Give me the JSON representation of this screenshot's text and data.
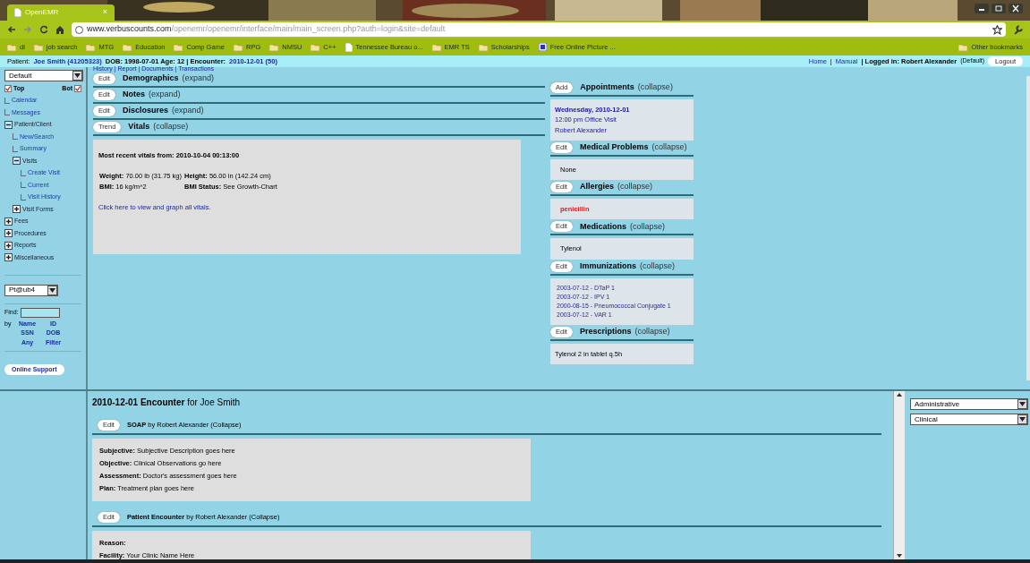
{
  "browser": {
    "tab": {
      "title": "OpenEMR",
      "close": "×"
    },
    "url": {
      "host": "www.verbuscounts.com",
      "path": "/openemr/openemr/interface/main/main_screen.php?auth=login&site=default"
    },
    "bookmarks": [
      {
        "label": "dl",
        "kind": "folder"
      },
      {
        "label": "job search",
        "kind": "folder"
      },
      {
        "label": "MTG",
        "kind": "folder"
      },
      {
        "label": "Education",
        "kind": "folder"
      },
      {
        "label": "Comp Game",
        "kind": "folder"
      },
      {
        "label": "RPG",
        "kind": "folder"
      },
      {
        "label": "NMSU",
        "kind": "folder"
      },
      {
        "label": "C++",
        "kind": "folder"
      },
      {
        "label": "Tennessee Bureau o...",
        "kind": "page"
      },
      {
        "label": "EMR TS",
        "kind": "folder"
      },
      {
        "label": "Scholarships",
        "kind": "folder"
      },
      {
        "label": "Free Online Picture ...",
        "kind": "app"
      }
    ],
    "other_bookmarks": "Other bookmarks"
  },
  "patient_bar": {
    "label": "Patient:",
    "patient": "Joe Smith (41205323)",
    "details": "DOB: 1998-07-01 Age: 12 | Encounter:",
    "encounter": "2010-12-01 (50)",
    "links": [
      "Home",
      "Manual"
    ],
    "separator": "|",
    "logged_in": "| Logged in: Robert Alexander",
    "role": "(Default)",
    "logout": "Logout"
  },
  "nav": {
    "view_select": "Default",
    "frames": [
      {
        "label": "Top",
        "checked": true
      },
      {
        "label": "Bot",
        "checked": true
      }
    ],
    "tree": [
      {
        "label": "Calendar"
      },
      {
        "label": "Messages"
      },
      {
        "label": "Patient/Client",
        "expanded": true,
        "children": [
          {
            "label": "New/Search"
          },
          {
            "label": "Summary"
          },
          {
            "label": "Visits",
            "expanded": true,
            "children": [
              {
                "label": "Create Visit"
              },
              {
                "label": "Current"
              },
              {
                "label": "Visit History"
              }
            ]
          },
          {
            "label": "Visit Forms",
            "expanded": false
          }
        ]
      },
      {
        "label": "Fees",
        "expanded": false
      },
      {
        "label": "Procedures",
        "expanded": false
      },
      {
        "label": "Reports",
        "expanded": false
      },
      {
        "label": "Miscellaneous",
        "expanded": false
      }
    ],
    "patient_select": "Pt@ub4",
    "find_label": "Find:",
    "by_label": "by",
    "search_by": [
      "Name",
      "ID",
      "SSN",
      "DOB",
      "Any",
      "Filter"
    ],
    "support": "Online Support"
  },
  "top_links": "History | Report | Documents | Transactions",
  "left_sections": [
    {
      "button": "Edit",
      "title": "Demographics",
      "toggle": "(expand)"
    },
    {
      "button": "Edit",
      "title": "Notes",
      "toggle": "(expand)"
    },
    {
      "button": "Edit",
      "title": "Disclosures",
      "toggle": "(expand)"
    },
    {
      "button": "Trend",
      "title": "Vitals",
      "toggle": "(collapse)",
      "vitals": {
        "heading": "Most recent vitals from: 2010-10-04 00:13:00",
        "cells": [
          "**Weight:** 70.00 lb (31.75 kg)",
          "**Height:** 56.00 in (142.24 cm)",
          "**BMI:** 16 kg/m^2",
          "**BMI Status:** See Growth-Chart"
        ],
        "link": "Click here to view and graph all vitals."
      }
    }
  ],
  "right_sections": [
    {
      "button": "Add",
      "title": "Appointments",
      "toggle": "(collapse)",
      "kind": "appointment",
      "lines": [
        "Wednesday, 2010-12-01",
        "12:00 pm Office Visit",
        "Robert Alexander"
      ]
    },
    {
      "button": "Edit",
      "title": "Medical Problems",
      "toggle": "(collapse)",
      "kind": "plain",
      "lines": [
        "None"
      ]
    },
    {
      "button": "Edit",
      "title": "Allergies",
      "toggle": "(collapse)",
      "kind": "alert",
      "lines": [
        "penicillin"
      ]
    },
    {
      "button": "Edit",
      "title": "Medications",
      "toggle": "(collapse)",
      "kind": "plain",
      "lines": [
        "Tylenol"
      ]
    },
    {
      "button": "Edit",
      "title": "Immunizations",
      "toggle": "(collapse)",
      "kind": "links",
      "lines": [
        "2003-07-12 - DTaP 1",
        "2003-07-12 - IPV 1",
        "2000-08-15 - Pneumococcal Conjugate 1",
        "2003-07-12 - VAR 1"
      ]
    },
    {
      "button": "Edit",
      "title": "Prescriptions",
      "toggle": "(collapse)",
      "kind": "plain",
      "lines": [
        "Tylenol 2 in tablet q.5h"
      ]
    }
  ],
  "encounter": {
    "title": "**2010-12-01 Encounter** for Joe Smith",
    "forms": [
      {
        "button": "Edit",
        "header": "**SOAP** by Robert Alexander (Collapse)",
        "lines": [
          "**Subjective:** Subjective Description goes here",
          "**Objective:** Clinical Observations go here",
          "**Assessment:** Doctor's assessment goes here",
          "**Plan:** Treatment plan goes here"
        ]
      },
      {
        "button": "Edit",
        "header": "**Patient Encounter** by Robert Alexander (Collapse)",
        "lines": [
          "**Reason:**",
          "**Facility:** Your Clinic Name Here"
        ]
      }
    ]
  },
  "form_menus": [
    "Administrative",
    "Clinical"
  ]
}
